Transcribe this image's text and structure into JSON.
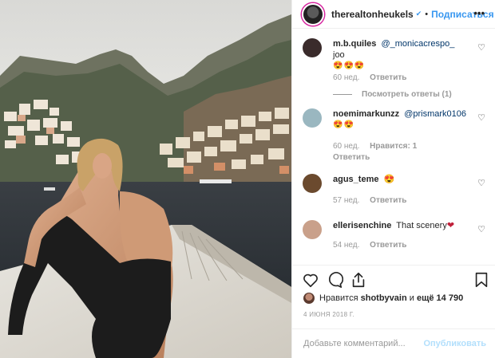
{
  "post": {
    "image_alt_icon": "boat-photo"
  },
  "header": {
    "username": "therealtonheukels",
    "verified_icon": "verified-badge-icon",
    "separator": "•",
    "follow_label": "Подписаться",
    "more_icon": "more-options-icon",
    "more_glyph": "•••"
  },
  "comments": [
    {
      "username": "m.b.quiles",
      "mention": "@_monicacrespo_",
      "text": "joo",
      "emoji": "😍😍😍",
      "time": "60 нед.",
      "reply_label": "Ответить",
      "likes_label": "",
      "view_replies": "Посмотреть ответы (1)",
      "avatar_color": "#3a2b2b"
    },
    {
      "username": "noemimarkunzz",
      "mention": "@prismark0106",
      "text": "",
      "emoji": "😍😍",
      "time": "60 нед.",
      "likes_label": "Нравится: 1",
      "reply_label": "Ответить",
      "avatar_color": "#9ab7c0"
    },
    {
      "username": "agus_teme",
      "mention": "",
      "text": "😍",
      "emoji": "",
      "time": "57 нед.",
      "reply_label": "Ответить",
      "avatar_color": "#6b4a2e"
    },
    {
      "username": "ellerisenchine",
      "mention": "",
      "text": "That scenery",
      "heart_emoji": "❤",
      "emoji": "",
      "time": "54 нед.",
      "reply_label": "Ответить",
      "avatar_color": "#c9a08a"
    }
  ],
  "actions": {
    "like_icon": "heart-icon",
    "comment_icon": "comment-icon",
    "share_icon": "share-icon",
    "save_icon": "bookmark-icon"
  },
  "likes": {
    "prefix": "Нравится",
    "user": "shotbyvain",
    "middle": "и",
    "rest": "ещё 14 790"
  },
  "date": "4 ИЮНЯ 2018 Г.",
  "add_comment": {
    "placeholder": "Добавьте комментарий...",
    "post_label": "Опубликовать"
  },
  "colors": {
    "link": "#3897f0",
    "muted": "#999999",
    "border": "#efefef",
    "heart": "#ed4956",
    "post_disabled": "#b2dffc"
  }
}
